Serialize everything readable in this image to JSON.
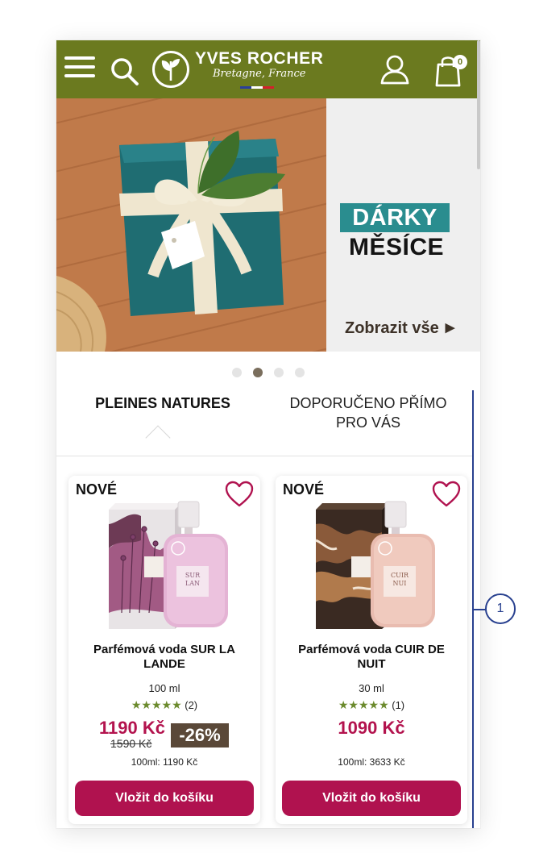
{
  "header": {
    "brand_name": "YVES ROCHER",
    "brand_sub": "Bretagne, France",
    "cart_count": "0",
    "color": "#6b7a1f",
    "icons": [
      "menu-icon",
      "search-icon",
      "logo-leaf-icon",
      "account-icon",
      "shopping-bag-icon"
    ]
  },
  "banner": {
    "tag": "DÁRKY",
    "title": "MĚSÍCE",
    "cta": "Zobrazit vše",
    "cta_arrow": "▶",
    "slides_total": 4,
    "active_slide": 2
  },
  "tabs": [
    {
      "label": "PLEINES NATURES",
      "active": true
    },
    {
      "label": "DOPORUČENO PŘÍMO PRO VÁS",
      "active": false
    }
  ],
  "products": [
    {
      "badge": "NOVÉ",
      "name": "Parfémová voda SUR LA LANDE",
      "volume": "100 ml",
      "stars": "★★★★★",
      "rating_value": 5,
      "review_count": "(2)",
      "price": "1190 Kč",
      "old_price": "1590 Kč",
      "discount": "-26%",
      "unit_price": "100ml: 1190 Kč",
      "button": "Vložit do košíku"
    },
    {
      "badge": "NOVÉ",
      "name": "Parfémová voda CUIR DE NUIT",
      "volume": "30 ml",
      "stars": "★★★★★",
      "rating_value": 5,
      "review_count": "(1)",
      "price": "1090 Kč",
      "unit_price": "100ml: 3633 Kč",
      "button": "Vložit do košíku"
    }
  ],
  "annotation": {
    "label": "1"
  },
  "colors": {
    "accent": "#b0124f",
    "teal": "#2a8d8f",
    "discount_bg": "#5a4838",
    "annotation": "#28408f"
  }
}
